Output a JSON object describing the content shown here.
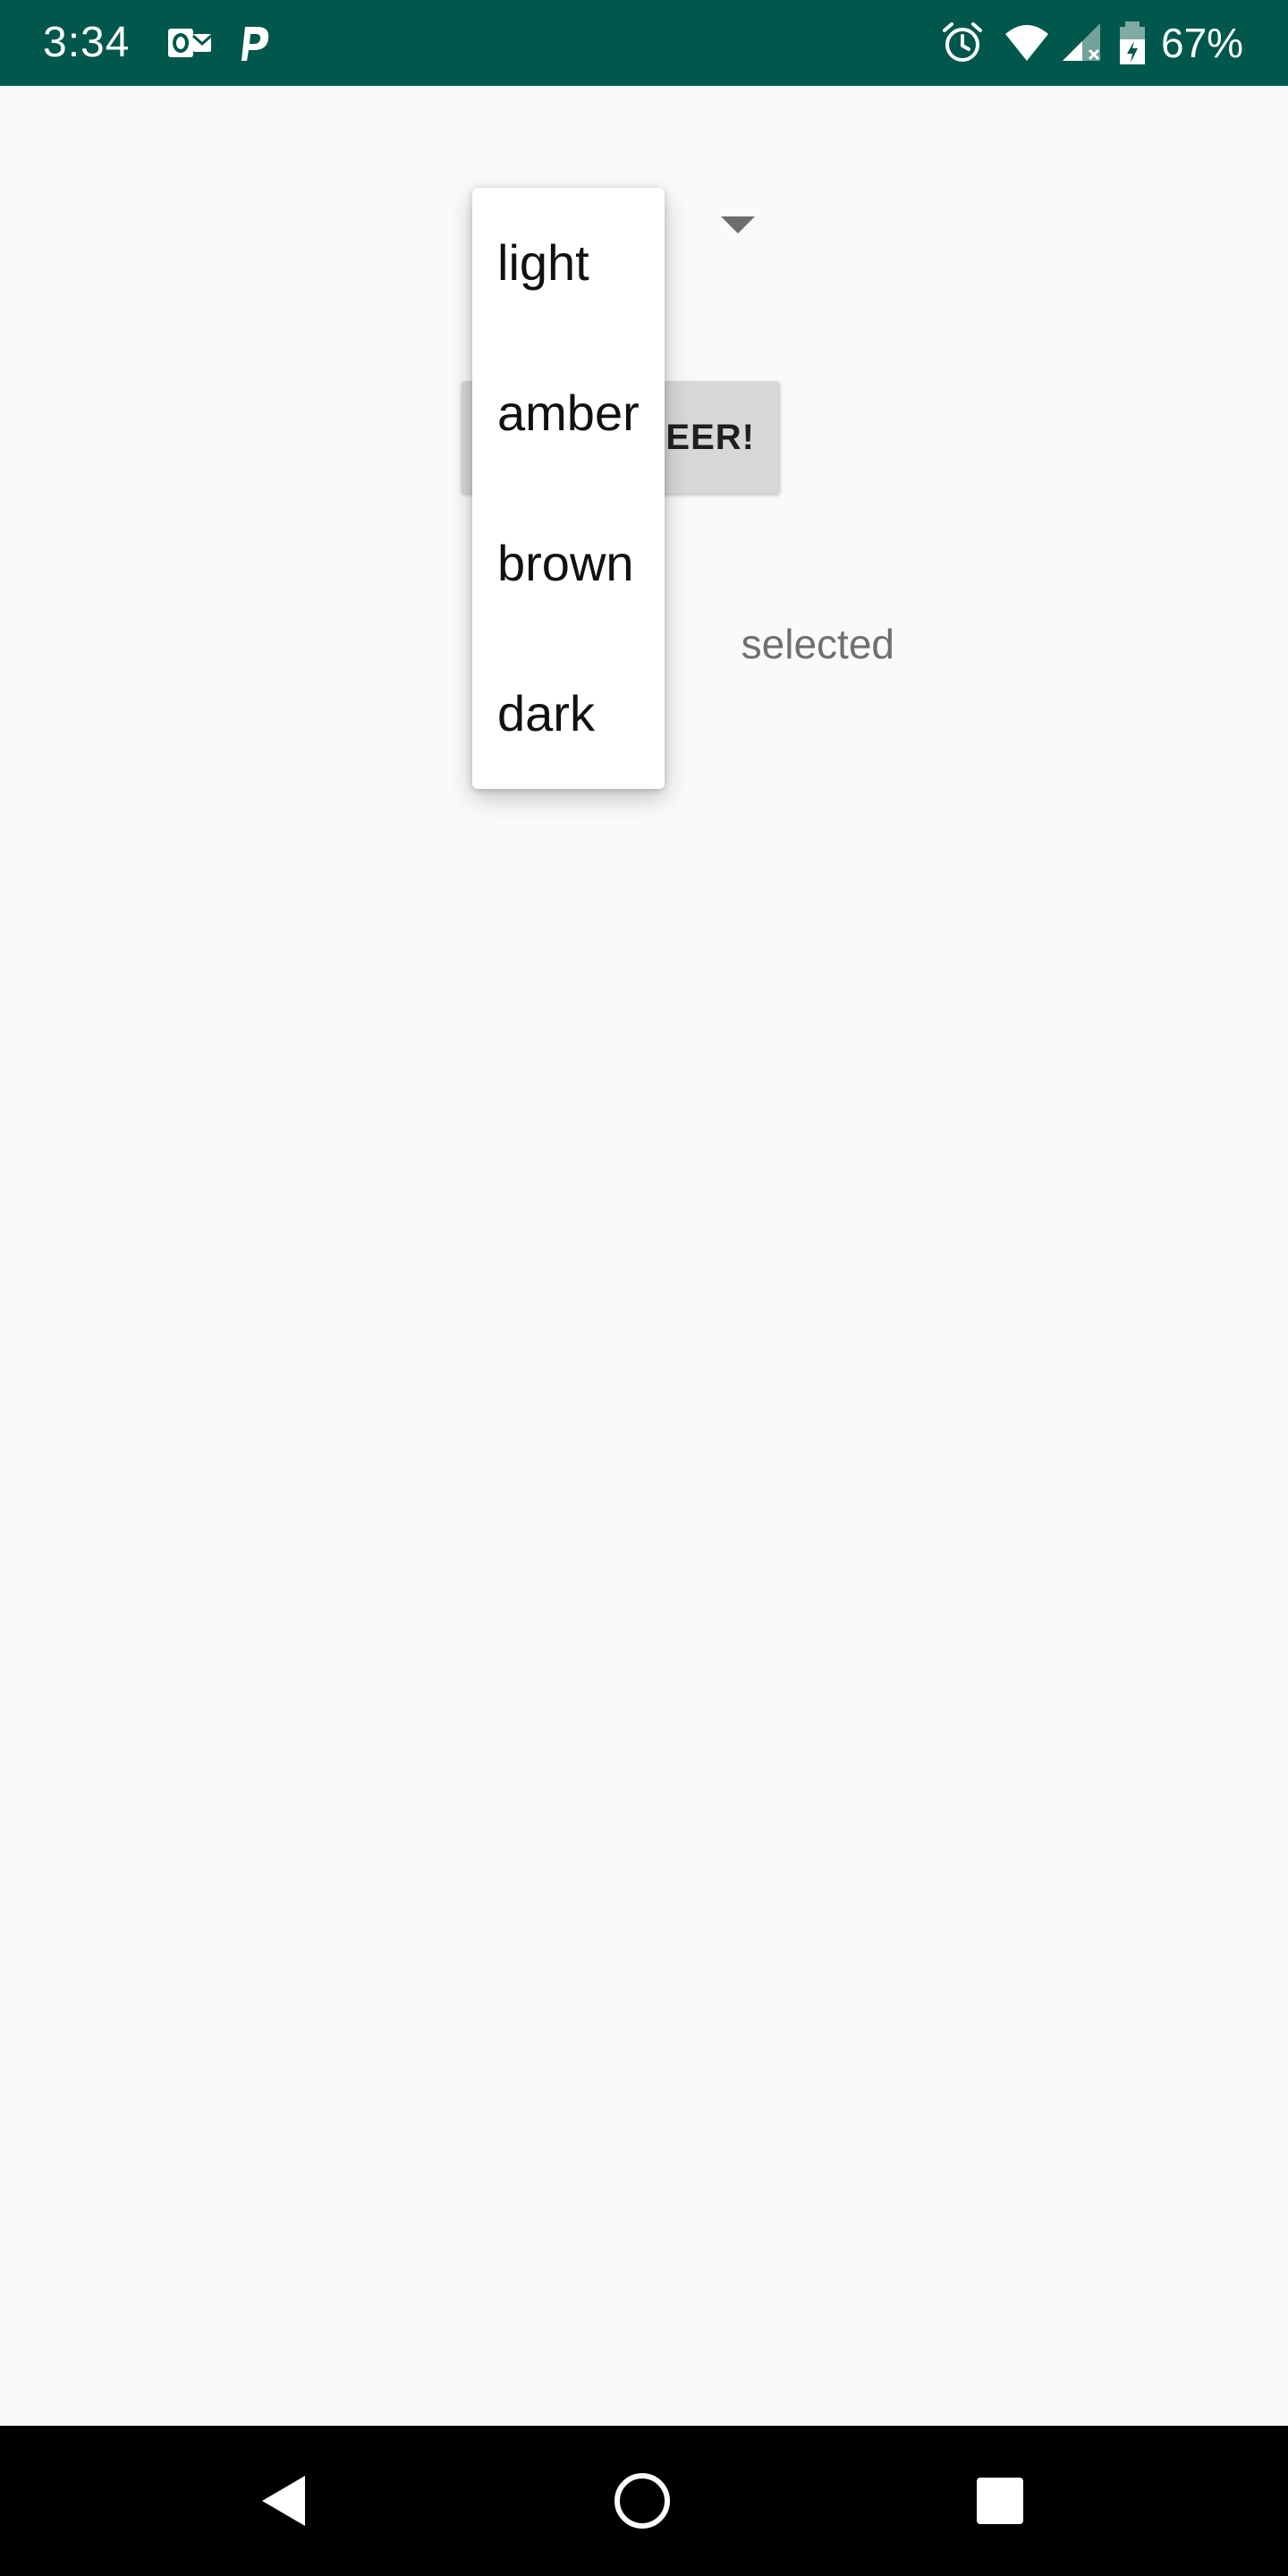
{
  "status_bar": {
    "time": "3:34",
    "battery_percent": "67%",
    "background_color": "#00574b",
    "icons": [
      "outlook-icon",
      "p-app-icon",
      "alarm-icon",
      "wifi-icon",
      "cell-signal-icon",
      "battery-icon"
    ]
  },
  "main": {
    "button_label": "EER!",
    "result_text": "selected"
  },
  "dropdown": {
    "options": [
      "light",
      "amber",
      "brown",
      "dark"
    ]
  },
  "nav_bar": {
    "icons": [
      "back-icon",
      "home-icon",
      "recents-icon"
    ]
  }
}
